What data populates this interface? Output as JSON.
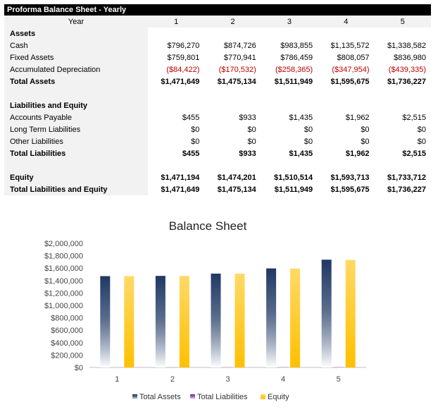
{
  "sheet": {
    "title": "Proforma Balance Sheet - Yearly",
    "header": {
      "label": "Year",
      "years": [
        "1",
        "2",
        "3",
        "4",
        "5"
      ]
    },
    "rows": [
      {
        "label": "Assets",
        "bold": true,
        "values": [
          "",
          "",
          "",
          "",
          ""
        ]
      },
      {
        "label": "Cash",
        "values": [
          "$796,270",
          "$874,726",
          "$983,855",
          "$1,135,572",
          "$1,338,582"
        ]
      },
      {
        "label": "Fixed Assets",
        "values": [
          "$759,801",
          "$770,941",
          "$786,459",
          "$808,057",
          "$836,980"
        ]
      },
      {
        "label": "Accumulated Depreciation",
        "neg": true,
        "values": [
          "($84,422)",
          "($170,532)",
          "($258,365)",
          "($347,954)",
          "($439,335)"
        ]
      },
      {
        "label": "Total Assets",
        "bold": true,
        "values": [
          "$1,471,649",
          "$1,475,134",
          "$1,511,949",
          "$1,595,675",
          "$1,736,227"
        ]
      },
      {
        "label": "",
        "values": [
          "",
          "",
          "",
          "",
          ""
        ]
      },
      {
        "label": "Liabilities and Equity",
        "bold": true,
        "values": [
          "",
          "",
          "",
          "",
          ""
        ]
      },
      {
        "label": "Accounts Payable",
        "values": [
          "$455",
          "$933",
          "$1,435",
          "$1,962",
          "$2,515"
        ]
      },
      {
        "label": "Long Term Liabilities",
        "values": [
          "$0",
          "$0",
          "$0",
          "$0",
          "$0"
        ]
      },
      {
        "label": "Other Liabilities",
        "values": [
          "$0",
          "$0",
          "$0",
          "$0",
          "$0"
        ]
      },
      {
        "label": "Total Liabilities",
        "bold": true,
        "values": [
          "$455",
          "$933",
          "$1,435",
          "$1,962",
          "$2,515"
        ]
      },
      {
        "label": "",
        "values": [
          "",
          "",
          "",
          "",
          ""
        ]
      },
      {
        "label": "Equity",
        "bold": true,
        "values": [
          "$1,471,194",
          "$1,474,201",
          "$1,510,514",
          "$1,593,713",
          "$1,733,712"
        ]
      },
      {
        "label": "Total Liabilities and Equity",
        "bold": true,
        "values": [
          "$1,471,649",
          "$1,475,134",
          "$1,511,949",
          "$1,595,675",
          "$1,736,227"
        ]
      }
    ]
  },
  "chart_data": {
    "type": "bar",
    "title": "Balance Sheet",
    "categories": [
      "1",
      "2",
      "3",
      "4",
      "5"
    ],
    "series": [
      {
        "name": "Total Assets",
        "values": [
          1471649,
          1475134,
          1511949,
          1595675,
          1736227
        ],
        "color": "#1f3864"
      },
      {
        "name": "Total Liabilities",
        "values": [
          455,
          933,
          1435,
          1962,
          2515
        ],
        "color": "#7030a0"
      },
      {
        "name": "Equity",
        "values": [
          1471194,
          1474201,
          1510514,
          1593713,
          1733712
        ],
        "color": "#ffc000"
      }
    ],
    "ylim": [
      0,
      2000000
    ],
    "yticks": [
      0,
      200000,
      400000,
      600000,
      800000,
      1000000,
      1200000,
      1400000,
      1600000,
      1800000,
      2000000
    ],
    "ytick_labels": [
      "$0",
      "$200,000",
      "$400,000",
      "$600,000",
      "$800,000",
      "$1,000,000",
      "$1,200,000",
      "$1,400,000",
      "$1,600,000",
      "$1,800,000",
      "$2,000,000"
    ],
    "legend_position": "bottom",
    "grid": false
  }
}
